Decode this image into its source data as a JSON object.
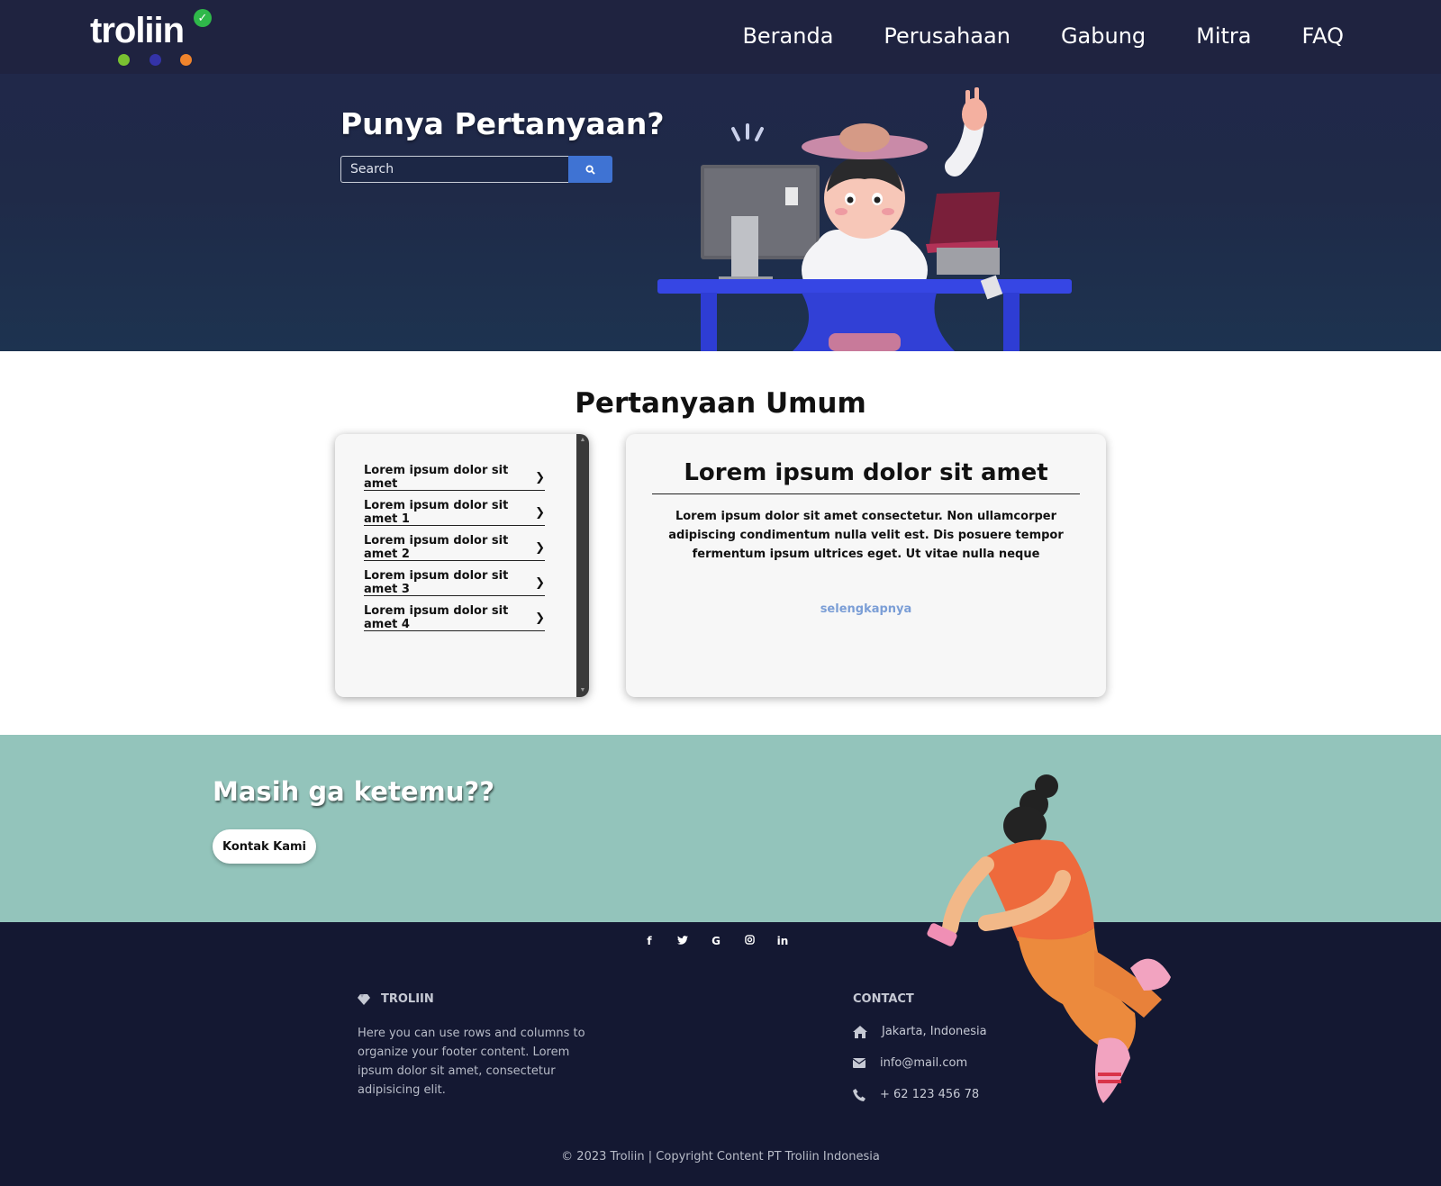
{
  "nav": {
    "logo_text": "troliin",
    "links": [
      "Beranda",
      "Perusahaan",
      "Gabung",
      "Mitra",
      "FAQ"
    ]
  },
  "hero": {
    "title": "Punya Pertanyaan?",
    "search_placeholder": "Search"
  },
  "faq": {
    "title": "Pertanyaan Umum",
    "questions": [
      "Lorem ipsum dolor sit amet",
      "Lorem ipsum dolor sit amet 1",
      "Lorem ipsum dolor sit amet 2",
      "Lorem ipsum dolor sit amet 3",
      "Lorem ipsum dolor sit amet 4"
    ],
    "answer_title": "Lorem ipsum dolor sit amet",
    "answer_body": "Lorem ipsum dolor sit amet consectetur. Non ullamcorper adipiscing condimentum nulla velit est. Dis posuere tempor fermentum ipsum ultrices eget. Ut vitae nulla neque",
    "more_link": "selengkapnya"
  },
  "cta": {
    "title": "Masih ga ketemu??",
    "button": "Kontak Kami"
  },
  "footer": {
    "social": [
      {
        "icon": "facebook-icon",
        "glyph": "f"
      },
      {
        "icon": "twitter-icon",
        "glyph": "🐦"
      },
      {
        "icon": "google-icon",
        "glyph": "G"
      },
      {
        "icon": "instagram-icon",
        "glyph": "◎"
      },
      {
        "icon": "linkedin-icon",
        "glyph": "in"
      }
    ],
    "brand": "TROLIIN",
    "brand_text": "Here you can use rows and columns to organize your footer content. Lorem ipsum dolor sit amet, consectetur adipisicing elit.",
    "contact_heading": "CONTACT",
    "address": "Jakarta, Indonesia",
    "email": "info@mail.com",
    "phone": "+ 62 123 456 78",
    "copyright": "© 2023 Troliin | Copyright Content PT Troliin Indonesia"
  },
  "colors": {
    "navbar_bg": "#1f2340",
    "search_button": "#3f73d3",
    "cta_bg": "#93c4bb",
    "footer_bg": "#141832",
    "link_blue": "#7b9ed6",
    "logo_check_green": "#2fb84a",
    "logo_dot_green": "#7ac231",
    "logo_dot_blue": "#3433a8",
    "logo_dot_orange": "#f0842c"
  }
}
